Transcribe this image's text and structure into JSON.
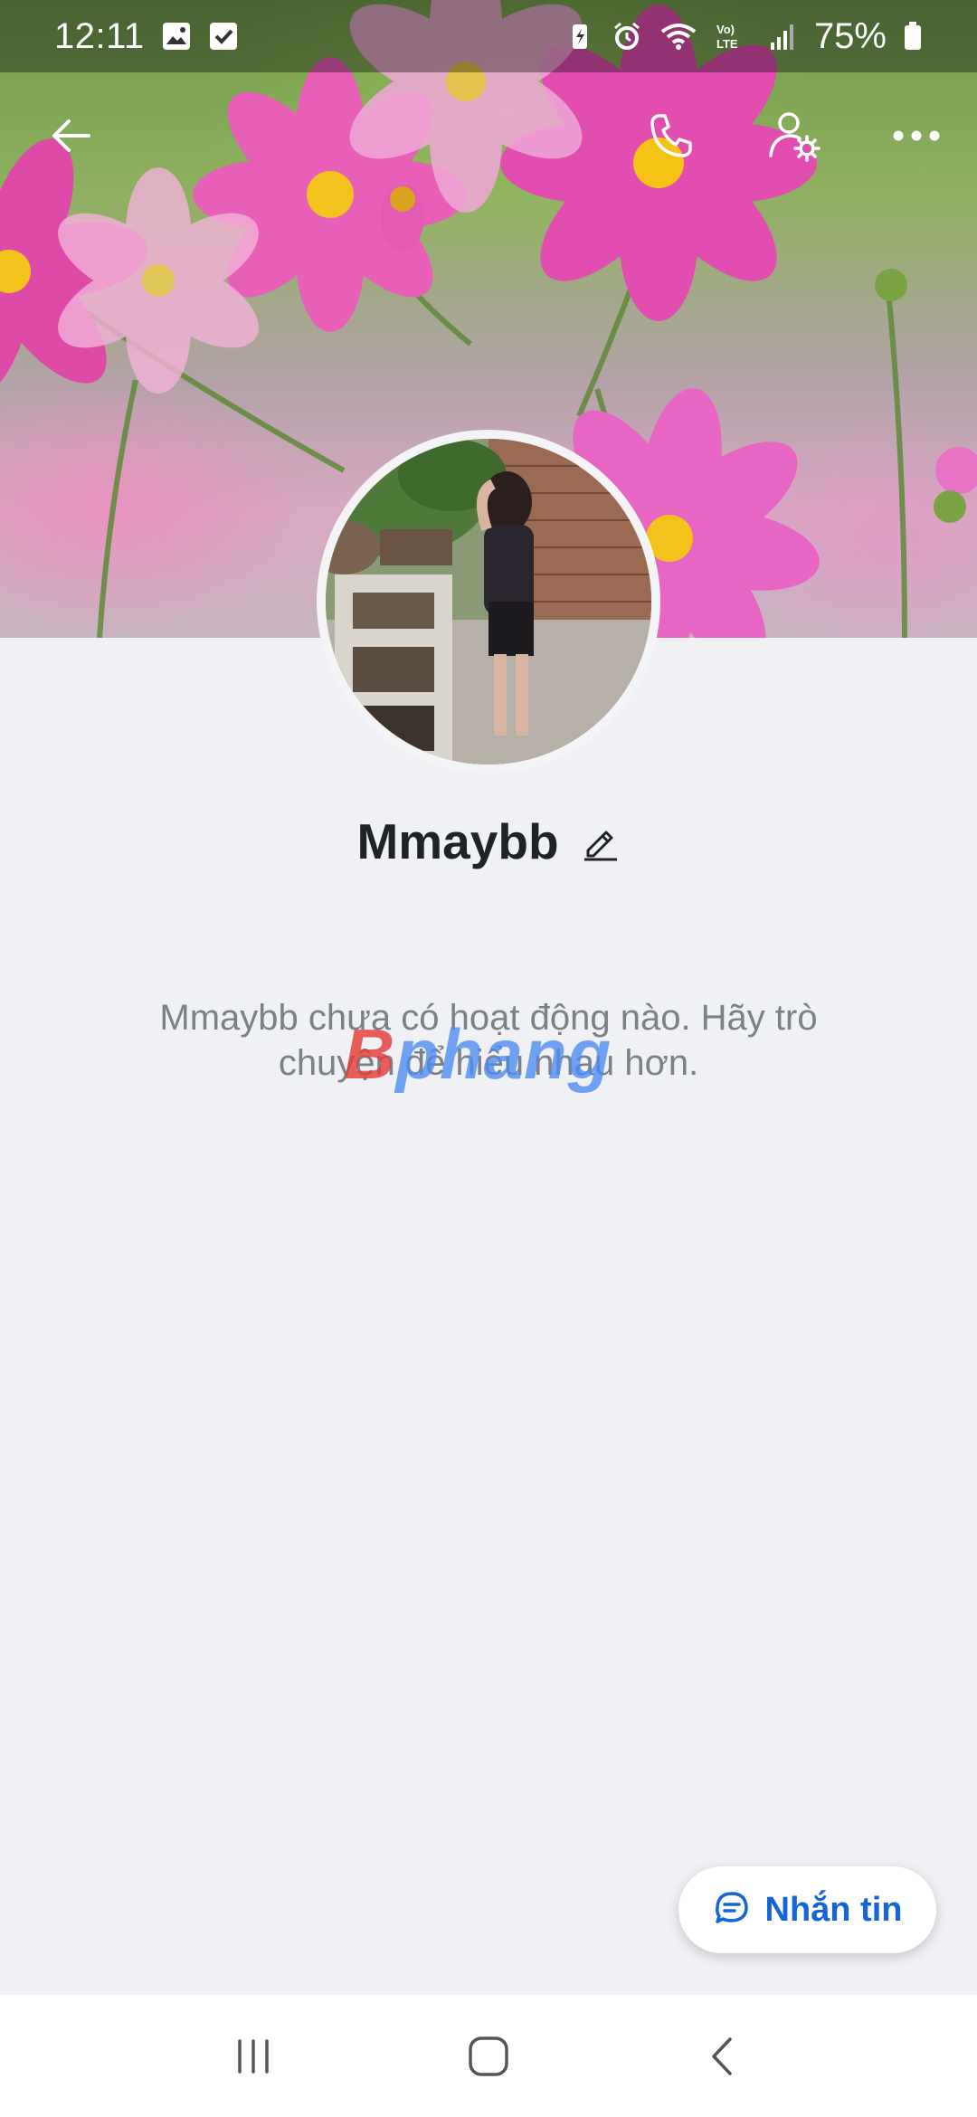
{
  "status_bar": {
    "time": "12:11",
    "battery": "75%",
    "icons": [
      "gallery-icon",
      "check-icon",
      "battery-saver-icon",
      "alarm-icon",
      "wifi-icon",
      "volte-icon",
      "signal-icon",
      "battery-icon"
    ]
  },
  "top_bar": {
    "icons": [
      "back-arrow-icon",
      "phone-icon",
      "profile-settings-icon",
      "more-icon"
    ]
  },
  "profile": {
    "name": "Mmaybb",
    "empty_message": "Mmaybb chưa có hoạt động nào. Hãy trò chuyện để hiểu nhau hơn."
  },
  "watermark": {
    "part1": "B",
    "part2": "phang"
  },
  "actions": {
    "message_label": "Nhắn tin"
  },
  "colors": {
    "accent": "#1565d8",
    "background": "#f0f1f5"
  }
}
